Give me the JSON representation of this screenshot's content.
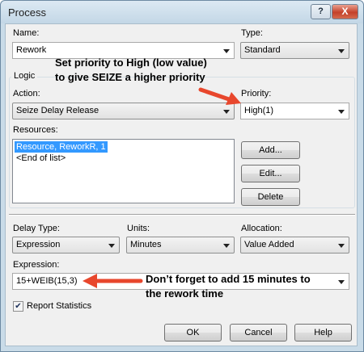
{
  "window": {
    "title": "Process",
    "help_button": "?",
    "close_button": "X"
  },
  "name_field": {
    "label": "Name:",
    "value": "Rework"
  },
  "type_field": {
    "label": "Type:",
    "value": "Standard"
  },
  "logic": {
    "group_label": "Logic",
    "action": {
      "label": "Action:",
      "value": "Seize Delay Release"
    },
    "priority": {
      "label": "Priority:",
      "value": "High(1)"
    },
    "resources": {
      "label": "Resources:",
      "items": [
        "Resource, ReworkR, 1",
        "<End of list>"
      ],
      "selected_index": 0
    },
    "buttons": {
      "add": "Add...",
      "edit": "Edit...",
      "delete": "Delete"
    }
  },
  "delay": {
    "delay_type": {
      "label": "Delay Type:",
      "value": "Expression"
    },
    "units": {
      "label": "Units:",
      "value": "Minutes"
    },
    "allocation": {
      "label": "Allocation:",
      "value": "Value Added"
    },
    "expression": {
      "label": "Expression:",
      "value": "15+WEIB(15,3)"
    }
  },
  "report_statistics": {
    "label": "Report Statistics",
    "checked": true
  },
  "footer": {
    "ok": "OK",
    "cancel": "Cancel",
    "help": "Help"
  },
  "annotations": {
    "priority_note_line1": "Set priority to High (low value)",
    "priority_note_line2": "to give SEIZE a higher priority",
    "expression_note_line1": "Don’t forget to add 15 minutes to",
    "expression_note_line2": "the rework time",
    "arrow_color": "#e8472d"
  },
  "icons": {
    "dropdown": "chevron-down-icon",
    "checkmark": "checkmark-icon",
    "arrow": "red-arrow-icon"
  }
}
